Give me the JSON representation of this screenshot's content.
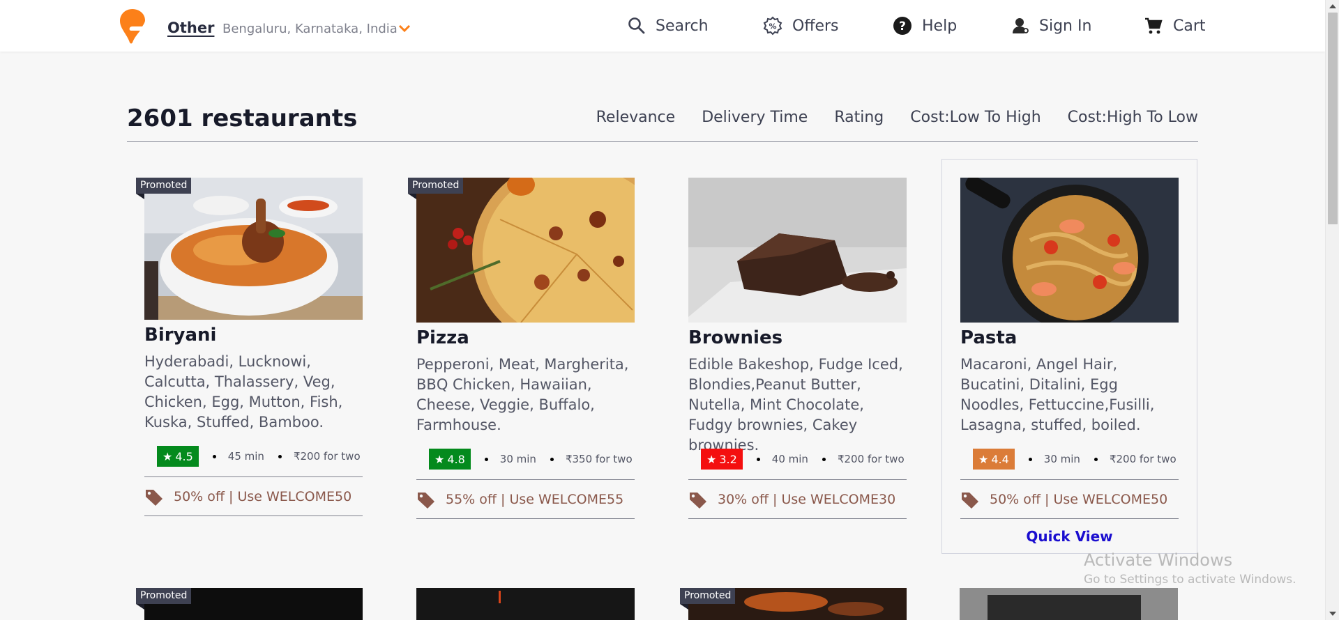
{
  "header": {
    "location_main": "Other",
    "location_sub": "Bengaluru, Karnataka, India",
    "nav": [
      {
        "label": "Search",
        "icon": "search-icon"
      },
      {
        "label": "Offers",
        "icon": "offers-icon"
      },
      {
        "label": "Help",
        "icon": "help-icon"
      },
      {
        "label": "Sign In",
        "icon": "user-icon"
      },
      {
        "label": "Cart",
        "icon": "cart-icon"
      }
    ]
  },
  "listing": {
    "count_title": "2601 restaurants",
    "sort_options": [
      "Relevance",
      "Delivery Time",
      "Rating",
      "Cost:Low To High",
      "Cost:High To Low"
    ]
  },
  "cards": [
    {
      "promoted": "Promoted",
      "name": "Biryani",
      "description": "Hyderabadi, Lucknowi, Calcutta, Thalassery, Veg, Chicken, Egg, Mutton, Fish, Kuska, Stuffed, Bamboo.",
      "rating": "4.5",
      "rating_color": "#048a1d",
      "time": "45 min",
      "cost": "₹200 for two",
      "offer": "50% off | Use WELCOME50"
    },
    {
      "promoted": "Promoted",
      "name": "Pizza",
      "description": "Pepperoni, Meat, Margherita, BBQ Chicken, Hawaiian, Cheese, Veggie, Buffalo, Farmhouse.",
      "rating": "4.8",
      "rating_color": "#048a1d",
      "time": "30 min",
      "cost": "₹350 for two",
      "offer": "55% off | Use WELCOME55"
    },
    {
      "promoted": "",
      "name": "Brownies",
      "description": "Edible Bakeshop, Fudge Iced, Blondies,Peanut Butter, Nutella, Mint Chocolate, Fudgy brownies, Cakey brownies.",
      "rating": "3.2",
      "rating_color": "#f40f0f",
      "time": "40 min",
      "cost": "₹200 for two",
      "offer": "30% off | Use WELCOME30"
    },
    {
      "promoted": "",
      "name": "Pasta",
      "description": "Macaroni, Angel Hair, Bucatini, Ditalini, Egg Noodles, Fettuccine,Fusilli, Lasagna, stuffed, boiled.",
      "rating": "4.4",
      "rating_color": "#db7c38",
      "time": "30 min",
      "cost": "₹200 for two",
      "offer": "50% off | Use WELCOME50",
      "quick_view": "Quick View"
    }
  ],
  "row2_promoted": [
    "Promoted",
    "",
    "Promoted",
    ""
  ],
  "watermark": {
    "title": "Activate Windows",
    "subtitle": "Go to Settings to activate Windows."
  },
  "colors": {
    "brand": "#fc8019",
    "offer_text": "#8a584b",
    "quick_view": "#1a0dcf"
  }
}
